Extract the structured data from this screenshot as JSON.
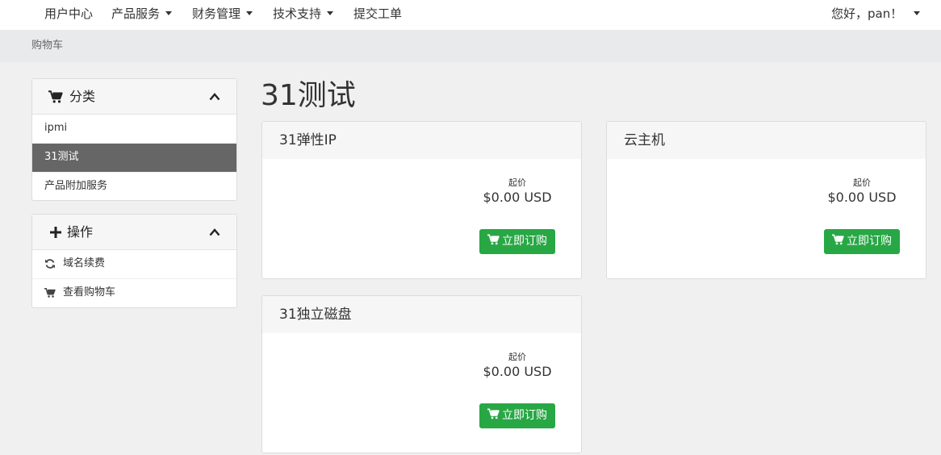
{
  "nav": {
    "items": [
      {
        "label": "用户中心",
        "dropdown": false
      },
      {
        "label": "产品服务",
        "dropdown": true
      },
      {
        "label": "财务管理",
        "dropdown": true
      },
      {
        "label": "技术支持",
        "dropdown": true
      },
      {
        "label": "提交工单",
        "dropdown": false
      }
    ],
    "user_greeting": "您好，pan！"
  },
  "breadcrumb": {
    "current": "购物车"
  },
  "sidebar": {
    "categories": {
      "title": "分类",
      "icon": "cart-icon",
      "items": [
        {
          "label": "ipmi",
          "active": false
        },
        {
          "label": "31测试",
          "active": true
        },
        {
          "label": "产品附加服务",
          "active": false
        }
      ]
    },
    "actions": {
      "title": "操作",
      "icon": "plus-icon",
      "items": [
        {
          "label": "域名续费",
          "icon": "refresh-icon"
        },
        {
          "label": "查看购物车",
          "icon": "cart-icon"
        }
      ]
    }
  },
  "main": {
    "title": "31测试",
    "products": [
      {
        "name": "31弹性IP",
        "price_label": "起价",
        "price": "$0.00 USD",
        "button": "立即订购"
      },
      {
        "name": "云主机",
        "price_label": "起价",
        "price": "$0.00 USD",
        "button": "立即订购"
      },
      {
        "name": "31独立磁盘",
        "price_label": "起价",
        "price": "$0.00 USD",
        "button": "立即订购"
      }
    ]
  },
  "colors": {
    "accent_green": "#28a745",
    "active_item": "#666666",
    "background": "#f0f0f0"
  }
}
